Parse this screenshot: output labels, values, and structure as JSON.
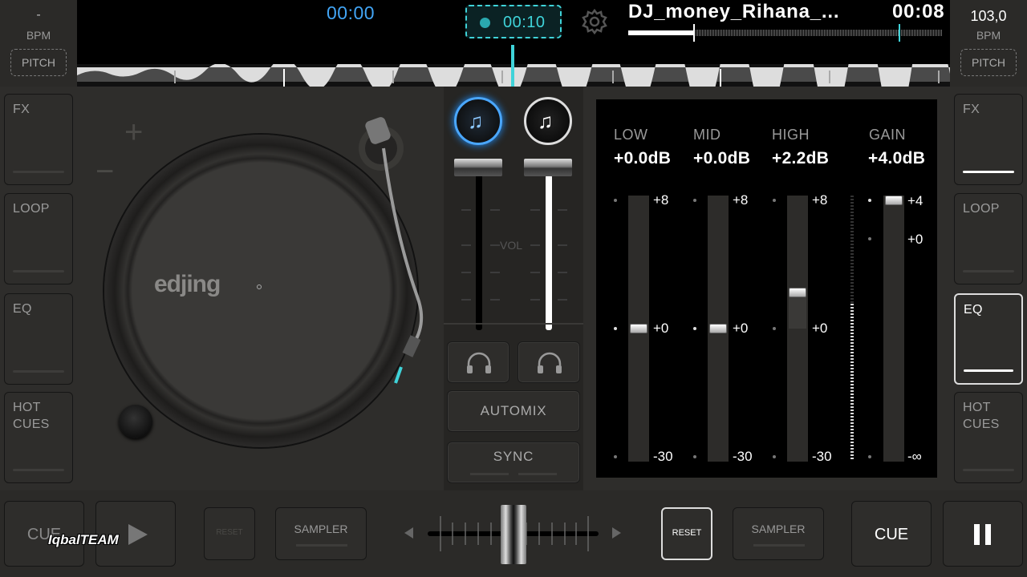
{
  "top": {
    "left_bpm_value": "-",
    "left_bpm_label": "BPM",
    "left_pitch": "PITCH",
    "left_time": "00:00",
    "record_time": "00:10",
    "track_title": "DJ_money_Rihana_...",
    "track_time": "00:08",
    "right_bpm_value": "103,0",
    "right_bpm_label": "BPM",
    "right_pitch": "PITCH"
  },
  "left_side": [
    {
      "label": "FX"
    },
    {
      "label": "LOOP"
    },
    {
      "label": "EQ"
    },
    {
      "label": "HOT\nCUES"
    }
  ],
  "right_side": [
    {
      "label": "FX"
    },
    {
      "label": "LOOP"
    },
    {
      "label": "EQ"
    },
    {
      "label": "HOT\nCUES"
    }
  ],
  "turntable": {
    "brand": "edjing",
    "plus": "+",
    "minus": "−"
  },
  "mixer": {
    "vol_label": "VOL",
    "automix": "AUTOMIX",
    "sync": "SYNC",
    "left_volume": 0.0,
    "right_volume": 1.0
  },
  "eq": {
    "bands": [
      {
        "name": "LOW",
        "value": "+0.0dB",
        "top": "+8",
        "mid": "+0",
        "bottom": "-30"
      },
      {
        "name": "MID",
        "value": "+0.0dB",
        "top": "+8",
        "mid": "+0",
        "bottom": "-30"
      },
      {
        "name": "HIGH",
        "value": "+2.2dB",
        "top": "+8",
        "mid": "+0",
        "bottom": "-30"
      },
      {
        "name": "GAIN",
        "value": "+4.0dB",
        "top": "+4",
        "mid": "+0",
        "bottom": "-∞"
      }
    ]
  },
  "bottom": {
    "left_cue": "CUE",
    "watermark": "IqbalTEAM",
    "left_reset": "RESET",
    "left_sampler": "SAMPLER",
    "right_reset": "RESET",
    "right_sampler": "SAMPLER",
    "right_cue": "CUE"
  },
  "colors": {
    "accent": "#3fd3d9",
    "time_blue": "#42a5f5",
    "deck_left": "#1e90ff"
  }
}
